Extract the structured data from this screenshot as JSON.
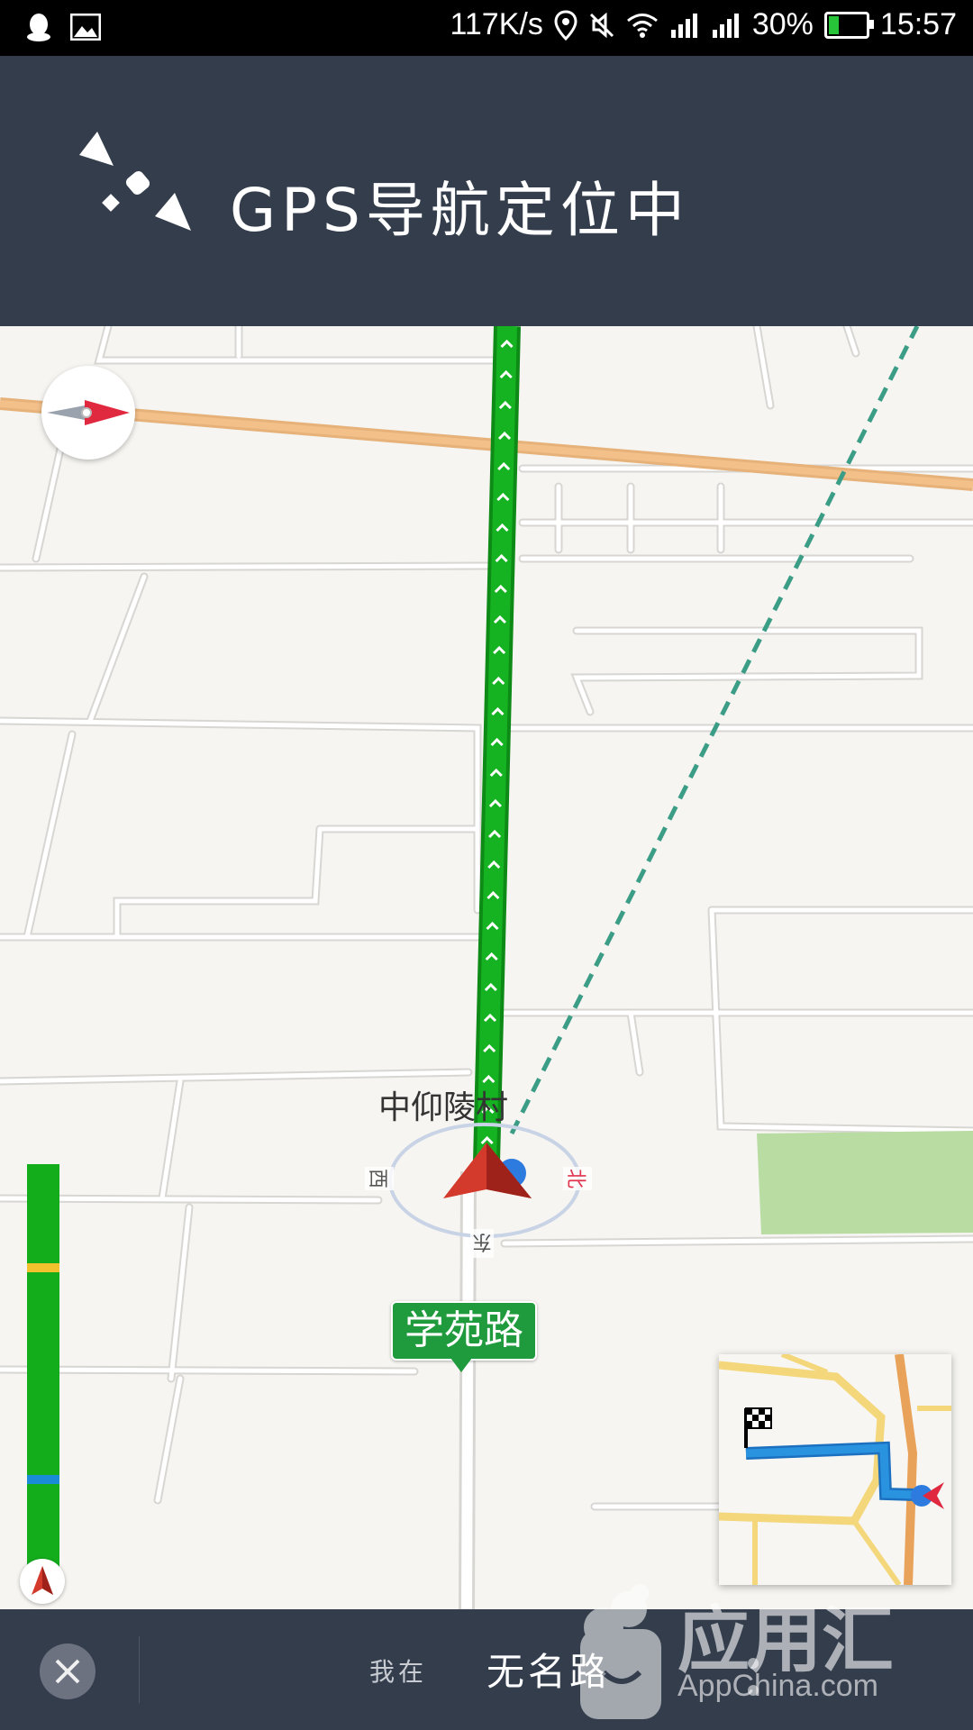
{
  "status_bar": {
    "speed": "117K/s",
    "battery": "30%",
    "battery_level": 0.3,
    "time": "15:57",
    "icons": [
      "qq-icon",
      "image-icon",
      "location-icon",
      "mute-icon",
      "wifi-icon",
      "signal-icon",
      "signal-icon",
      "battery-icon"
    ]
  },
  "header": {
    "title": "GPS导航定位中",
    "icon": "satellite-icon"
  },
  "map": {
    "place_name": "中仰陵村",
    "directions": {
      "west": "西",
      "north": "北",
      "east": "东"
    },
    "road_tag": "学苑路",
    "route_color": "#12a51a",
    "compass_icon": "compass-icon"
  },
  "progress": {
    "accent": "#13ad1c",
    "marker_yellow": "#f2c12e",
    "marker_blue": "#1a8bd6"
  },
  "bottom_bar": {
    "close_icon": "close-icon",
    "label": "我在",
    "road": "无名路"
  },
  "watermark": {
    "brand": "应用汇",
    "sub": "AppChina.com"
  }
}
